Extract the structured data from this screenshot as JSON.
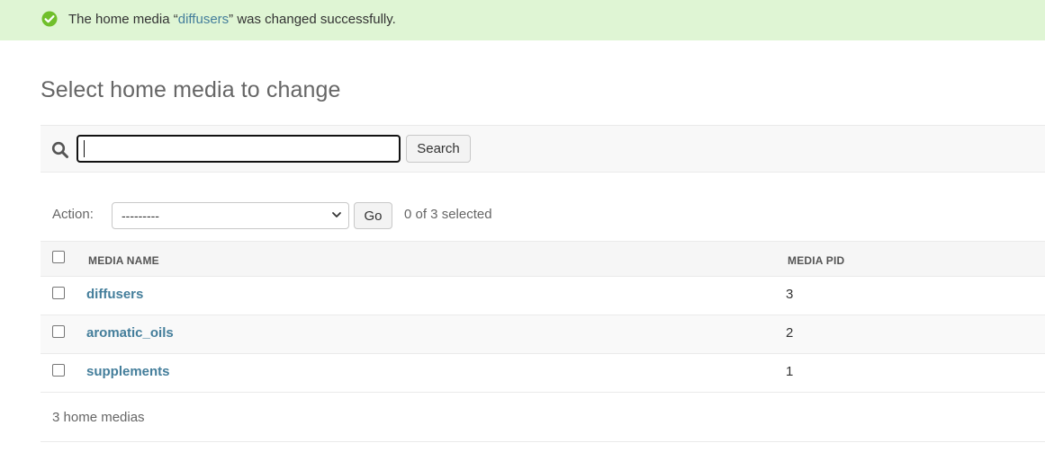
{
  "message": {
    "prefix": "The home media “",
    "link_text": "diffusers",
    "suffix": "” was changed successfully.",
    "icon": "success-check-icon",
    "color": "#dff5d4"
  },
  "page_title": "Select home media to change",
  "search": {
    "value": "",
    "button_label": "Search"
  },
  "actions": {
    "label": "Action:",
    "selected_option": "---------",
    "go_label": "Go",
    "counter": "0 of 3 selected"
  },
  "table": {
    "columns": [
      "MEDIA NAME",
      "MEDIA PID"
    ],
    "rows": [
      {
        "name": "diffusers",
        "pid": "3"
      },
      {
        "name": "aromatic_oils",
        "pid": "2"
      },
      {
        "name": "supplements",
        "pid": "1"
      }
    ]
  },
  "paginator": "3 home medias",
  "colors": {
    "link": "#447e9b",
    "success_bg": "#dff5d4",
    "success_icon": "#70bf2b"
  }
}
